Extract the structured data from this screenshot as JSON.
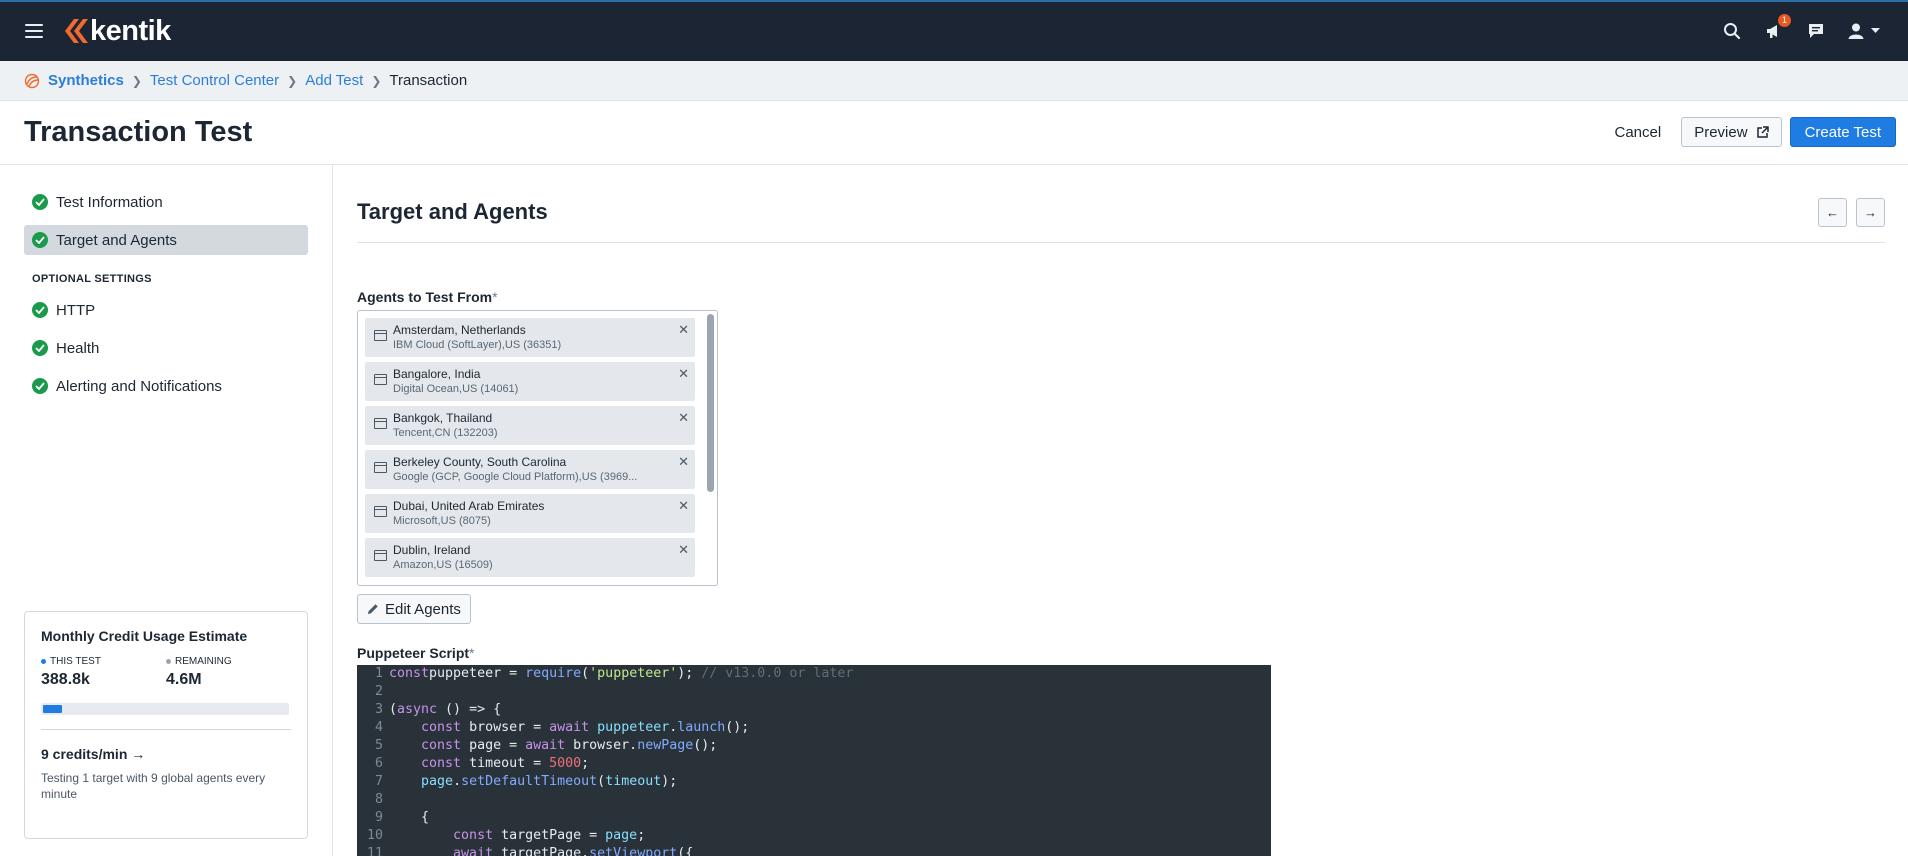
{
  "app": {
    "logo_text": "kentik",
    "notification_count": "1"
  },
  "breadcrumb": {
    "items": [
      "Synthetics",
      "Test Control Center",
      "Add Test"
    ],
    "current": "Transaction"
  },
  "header": {
    "title": "Transaction Test",
    "cancel_label": "Cancel",
    "preview_label": "Preview",
    "create_label": "Create Test"
  },
  "nav": {
    "items": [
      "Test Information",
      "Target and Agents"
    ],
    "section_label": "OPTIONAL SETTINGS",
    "optional_items": [
      "HTTP",
      "Health",
      "Alerting and Notifications"
    ]
  },
  "credits": {
    "title": "Monthly Credit Usage Estimate",
    "this_test_label": "THIS TEST",
    "this_test_value": "388.8k",
    "remaining_label": "REMAINING",
    "remaining_value": "4.6M",
    "usage_fraction": 0.078,
    "rate": "9 credits/min →",
    "description": "Testing 1 target with 9 global agents every minute"
  },
  "main": {
    "section_title": "Target and Agents",
    "agents_label": "Agents to Test From",
    "required_mark": "*",
    "agents": [
      {
        "name": "Amsterdam, Netherlands",
        "sub": "IBM Cloud (SoftLayer),US (36351)"
      },
      {
        "name": "Bangalore, India",
        "sub": "Digital Ocean,US (14061)"
      },
      {
        "name": "Bankgok, Thailand",
        "sub": "Tencent,CN (132203)"
      },
      {
        "name": "Berkeley County, South Carolina",
        "sub": "Google (GCP, Google Cloud Platform),US (3969..."
      },
      {
        "name": "Dubai, United Arab Emirates",
        "sub": "Microsoft,US (8075)"
      },
      {
        "name": "Dublin, Ireland",
        "sub": "Amazon,US (16509)"
      }
    ],
    "edit_agents_label": "Edit Agents",
    "script_label": "Puppeteer Script",
    "code_lines": [
      {
        "n": "1",
        "tokens": [
          [
            "kw",
            "const"
          ],
          [
            "",
            "puppeteer = "
          ],
          [
            "fn",
            "require"
          ],
          [
            "",
            "("
          ],
          [
            "str",
            "'puppeteer'"
          ],
          [
            "",
            "); "
          ],
          [
            "cmt",
            "// v13.0.0 or later"
          ]
        ]
      },
      {
        "n": "2",
        "tokens": []
      },
      {
        "n": "3",
        "tokens": [
          [
            "",
            "("
          ],
          [
            "kw",
            "async"
          ],
          [
            "",
            " () => {"
          ]
        ]
      },
      {
        "n": "4",
        "tokens": [
          [
            "",
            "    "
          ],
          [
            "kw",
            "const"
          ],
          [
            "",
            " browser = "
          ],
          [
            "kw",
            "await"
          ],
          [
            "",
            " "
          ],
          [
            "prop",
            "puppeteer"
          ],
          [
            "",
            "."
          ],
          [
            "fn",
            "launch"
          ],
          [
            "",
            "();"
          ]
        ]
      },
      {
        "n": "5",
        "tokens": [
          [
            "",
            "    "
          ],
          [
            "kw",
            "const"
          ],
          [
            "",
            " page = "
          ],
          [
            "kw",
            "await"
          ],
          [
            "",
            " browser."
          ],
          [
            "fn",
            "newPage"
          ],
          [
            "",
            "();"
          ]
        ]
      },
      {
        "n": "6",
        "tokens": [
          [
            "",
            "    "
          ],
          [
            "kw",
            "const"
          ],
          [
            "",
            " timeout = "
          ],
          [
            "num",
            "5000"
          ],
          [
            "",
            ";"
          ]
        ]
      },
      {
        "n": "7",
        "tokens": [
          [
            "",
            "    "
          ],
          [
            "prop",
            "page"
          ],
          [
            "",
            "."
          ],
          [
            "fn",
            "setDefaultTimeout"
          ],
          [
            "",
            "("
          ],
          [
            "prop",
            "timeout"
          ],
          [
            "",
            ");"
          ]
        ]
      },
      {
        "n": "8",
        "tokens": []
      },
      {
        "n": "9",
        "tokens": [
          [
            "",
            "    {"
          ]
        ]
      },
      {
        "n": "10",
        "tokens": [
          [
            "",
            "        "
          ],
          [
            "kw",
            "const"
          ],
          [
            "",
            " targetPage = "
          ],
          [
            "prop",
            "page"
          ],
          [
            "",
            ";"
          ]
        ]
      },
      {
        "n": "11",
        "tokens": [
          [
            "",
            "        "
          ],
          [
            "kw",
            "await"
          ],
          [
            "",
            " targetPage."
          ],
          [
            "fn",
            "setViewport"
          ],
          [
            "",
            "({"
          ]
        ]
      }
    ]
  },
  "colors": {
    "topbar": "#1b2533",
    "accent": "#1f7ce3",
    "success": "#1a9a4a",
    "logo_orange": "#f26a2e"
  }
}
